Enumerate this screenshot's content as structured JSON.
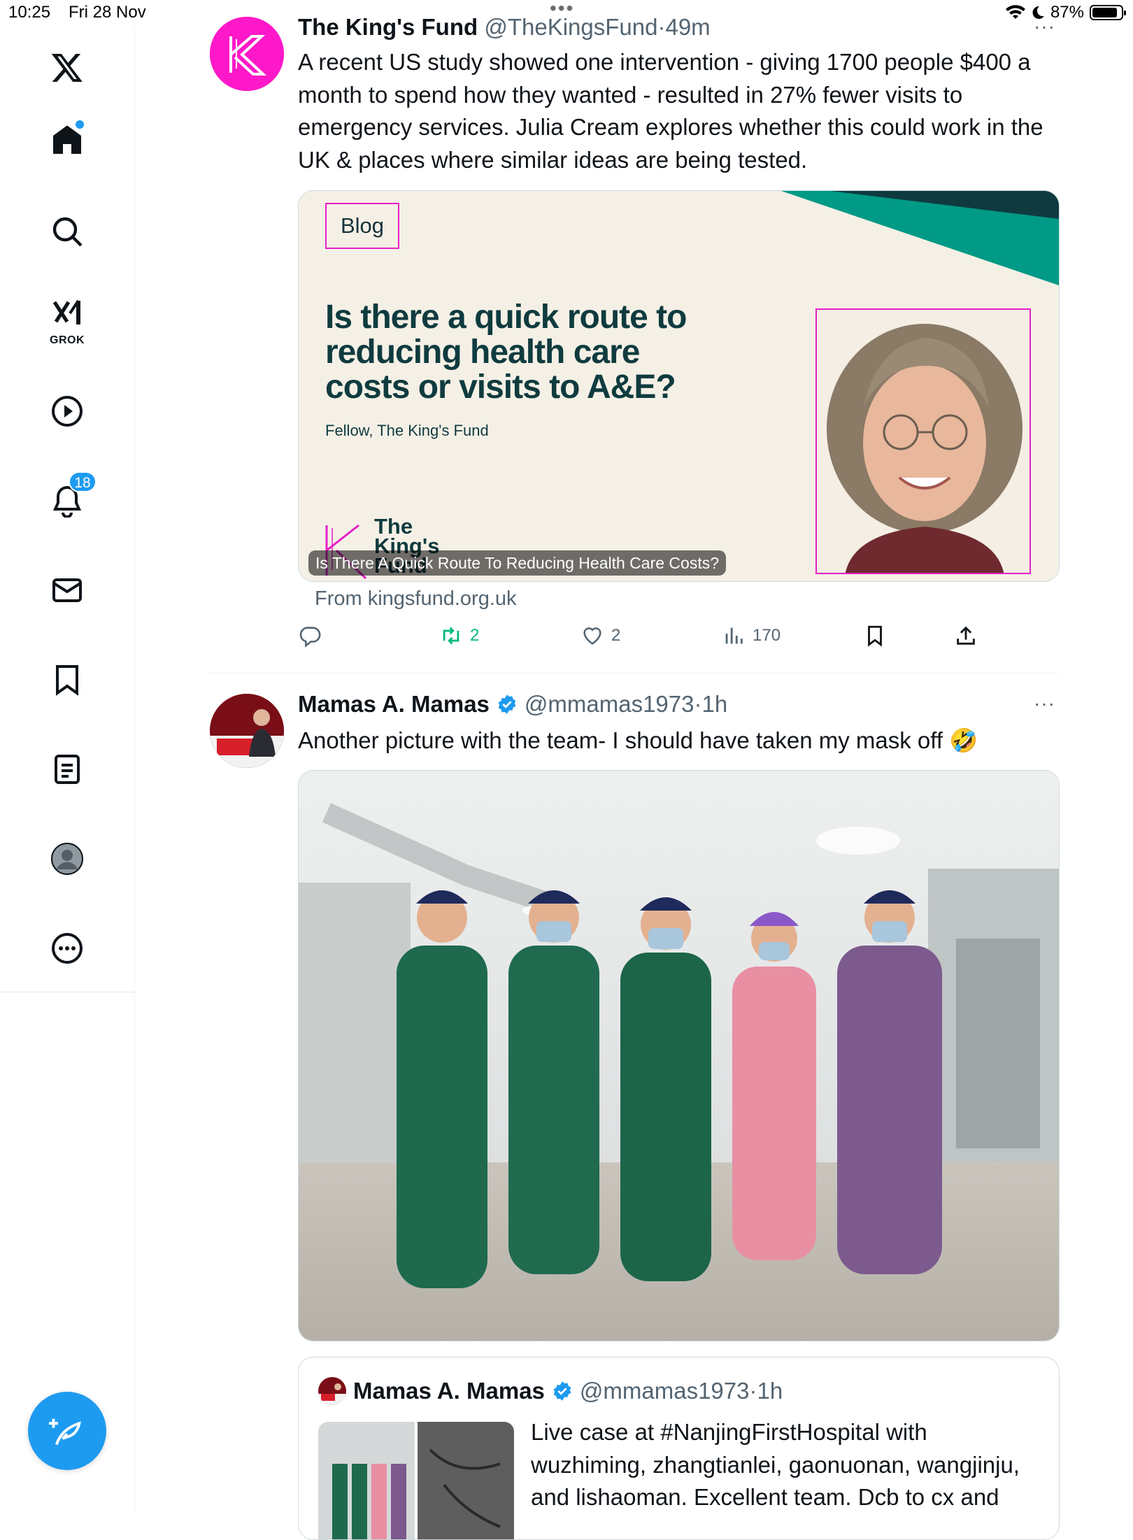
{
  "status_bar": {
    "time": "10:25",
    "date": "Fri 28 Nov",
    "battery_text": "87%",
    "battery_level": 0.87
  },
  "nav": {
    "items": [
      {
        "name": "X",
        "icon": "x-logo-icon"
      },
      {
        "name": "Home",
        "icon": "home-icon",
        "has_dot": true
      },
      {
        "name": "Explore",
        "icon": "search-icon"
      },
      {
        "name": "Grok",
        "icon": "grok-icon",
        "label": "GROK"
      },
      {
        "name": "Video",
        "icon": "play-icon"
      },
      {
        "name": "Notifications",
        "icon": "bell-icon",
        "badge": "18"
      },
      {
        "name": "Messages",
        "icon": "mail-icon"
      },
      {
        "name": "Bookmarks",
        "icon": "bookmark-icon"
      },
      {
        "name": "Lists",
        "icon": "list-icon"
      },
      {
        "name": "Profile",
        "icon": "profile-icon"
      },
      {
        "name": "More",
        "icon": "more-icon"
      }
    ],
    "compose_icon": "compose-icon",
    "accent": "#1d9bf0"
  },
  "tweets": [
    {
      "name": "The King's Fund",
      "handle": "@TheKingsFund",
      "sep": "·",
      "time": "49m",
      "text": "A recent US study showed one intervention - giving 1700 people $400 a month to spend how they wanted - resulted in 27% fewer visits to emergency services. Julia Cream explores whether this could work in the UK & places where similar ideas are being tested.",
      "card": {
        "tag": "Blog",
        "title": "Is there a quick route to reducing health care costs or visits to A&E?",
        "subtitle": "Fellow, The King's Fund",
        "logo_text": "The King's Fund",
        "caption": "Is There A Quick Route To Reducing Health Care Costs?",
        "from": "From kingsfund.org.uk"
      },
      "stats": {
        "replies": "",
        "retweets": "2",
        "likes": "2",
        "views": "170"
      }
    },
    {
      "name": "Mamas A. Mamas",
      "handle": "@mmamas1973",
      "sep": "·",
      "time": "1h",
      "text": "Another picture with the team- I should have taken my mask off 🤣",
      "quote": {
        "name": "Mamas A. Mamas",
        "handle": "@mmamas1973",
        "sep": "·",
        "time": "1h",
        "text": "Live case at #NanjingFirstHospital with wuzhiming, zhangtianlei, gaonuonan, wangjinju, and lishaoman. Excellent team. Dcb to cx and"
      }
    }
  ],
  "colors": {
    "brand_magenta": "#e61fc8",
    "kf_teal": "#0f3b3f",
    "retweet_green": "#00ba7c",
    "text_secondary": "#536471"
  }
}
